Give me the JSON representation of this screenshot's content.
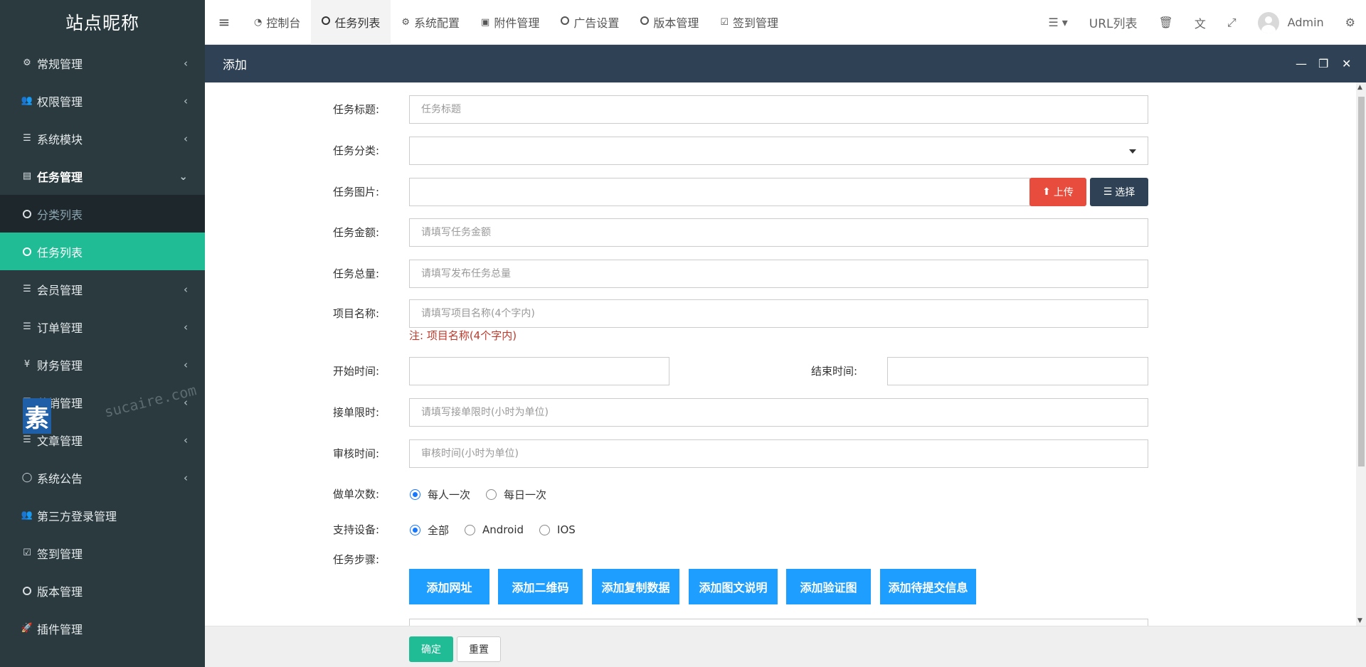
{
  "site_title": "站点昵称",
  "sidebar": {
    "items": [
      {
        "label": "常规管理",
        "icon": "cogs-icon"
      },
      {
        "label": "权限管理",
        "icon": "users-icon"
      },
      {
        "label": "系统模块",
        "icon": "list-icon"
      },
      {
        "label": "任务管理",
        "icon": "list-alt-icon"
      },
      {
        "label": "分类列表",
        "icon": "circle-icon"
      },
      {
        "label": "任务列表",
        "icon": "circle-icon"
      },
      {
        "label": "会员管理",
        "icon": "list-icon"
      },
      {
        "label": "订单管理",
        "icon": "list-icon"
      },
      {
        "label": "财务管理",
        "icon": "yen-icon"
      },
      {
        "label": "营销管理",
        "icon": "list-icon"
      },
      {
        "label": "文章管理",
        "icon": "list-icon"
      },
      {
        "label": "系统公告",
        "icon": "comment-icon"
      },
      {
        "label": "第三方登录管理",
        "icon": "users-icon"
      },
      {
        "label": "签到管理",
        "icon": "calendar-check-icon"
      },
      {
        "label": "版本管理",
        "icon": "circle-icon"
      },
      {
        "label": "插件管理",
        "icon": "rocket-icon"
      }
    ]
  },
  "topnav": {
    "tabs": [
      {
        "label": "控制台",
        "icon": "dashboard-icon"
      },
      {
        "label": "任务列表",
        "icon": "circle-icon"
      },
      {
        "label": "系统配置",
        "icon": "cog-icon"
      },
      {
        "label": "附件管理",
        "icon": "image-file-icon"
      },
      {
        "label": "广告设置",
        "icon": "circle-icon"
      },
      {
        "label": "版本管理",
        "icon": "circle-icon"
      },
      {
        "label": "签到管理",
        "icon": "calendar-check-icon"
      }
    ],
    "url_list": "URL列表",
    "user": "Admin"
  },
  "modal": {
    "title": "添加"
  },
  "form": {
    "title_label": "任务标题:",
    "title_placeholder": "任务标题",
    "category_label": "任务分类:",
    "image_label": "任务图片:",
    "upload_btn": "上传",
    "choose_btn": "选择",
    "amount_label": "任务金额:",
    "amount_placeholder": "请填写任务金额",
    "total_label": "任务总量:",
    "total_placeholder": "请填写发布任务总量",
    "project_label": "项目名称:",
    "project_placeholder": "请填写项目名称(4个字内)",
    "project_note": "注:  项目名称(4个字内)",
    "start_label": "开始时间:",
    "end_label": "结束时间:",
    "limit_label": "接单限时:",
    "limit_placeholder": "请填写接单限时(小时为单位)",
    "review_label": "审核时间:",
    "review_placeholder": "审核时间(小时为单位)",
    "times_label": "做单次数:",
    "times_options": [
      "每人一次",
      "每日一次"
    ],
    "device_label": "支持设备:",
    "device_options": [
      "全部",
      "Android",
      "IOS"
    ],
    "steps_label": "任务步骤:",
    "step_buttons": [
      "添加网址",
      "添加二维码",
      "添加复制数据",
      "添加图文说明",
      "添加验证图",
      "添加待提交信息"
    ]
  },
  "footer": {
    "confirm": "确定",
    "reset": "重置"
  },
  "watermark": {
    "char": "素",
    "text": "sucaire.com"
  },
  "colors": {
    "sidebar_bg": "#2a3a3f",
    "active_green": "#1fbc95",
    "modal_header": "#2e4155",
    "step_blue": "#1e9fff",
    "upload_red": "#e74c3c"
  }
}
